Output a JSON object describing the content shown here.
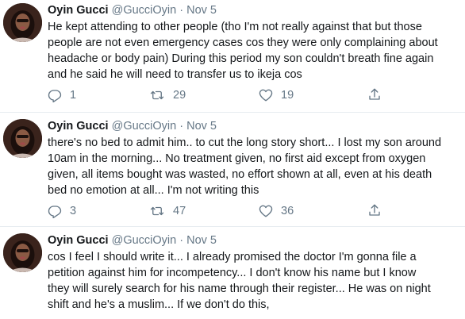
{
  "tweets": [
    {
      "name": "Oyin Gucci",
      "handle": "@GucciOyin",
      "separator": "·",
      "date": "Nov 5",
      "text": "He kept attending to other people (tho I'm not really against that but those\npeople are not even emergency cases cos they were only complaining about\nheadache or body pain) During this period my son couldn't breath fine again\nand he said he will need to transfer us to ikeja cos",
      "replies": "1",
      "retweets": "29",
      "likes": "19"
    },
    {
      "name": "Oyin Gucci",
      "handle": "@GucciOyin",
      "separator": "·",
      "date": "Nov 5",
      "text": "there's no bed to admit him.. to cut the long story short... I lost my son around\n10am in the morning... No treatment given, no first aid except from oxygen\ngiven, all items bought was wasted, no effort shown at all, even at his death\nbed no emotion at all... I'm not writing this",
      "replies": "3",
      "retweets": "47",
      "likes": "36"
    },
    {
      "name": "Oyin Gucci",
      "handle": "@GucciOyin",
      "separator": "·",
      "date": "Nov 5",
      "text": "cos I feel I should write it... I already promised the doctor I'm gonna file a\npetition against him for incompetency... I don't know his name but I know\nthey will surely search for his name through their  register... He was on night\nshift and he's a muslim... If we don't do this,",
      "replies": "",
      "retweets": "",
      "likes": ""
    }
  ],
  "icons": {
    "reply": "reply-icon",
    "retweet": "retweet-icon",
    "like": "heart-icon",
    "share": "share-icon"
  },
  "colors": {
    "text": "#14171a",
    "muted": "#657786",
    "divider": "#e6ecf0"
  }
}
